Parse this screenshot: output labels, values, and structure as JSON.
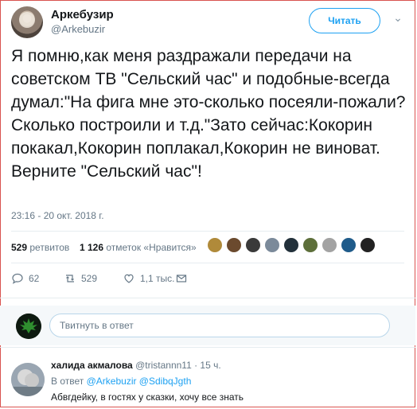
{
  "author": {
    "name": "Аркебузир",
    "handle": "@Arkebuzir",
    "follow_label": "Читать"
  },
  "tweet": {
    "text": "Я помню,как меня раздражали передачи на советском ТВ \"Сельский час\" и подобные-всегда думал:\"На фига мне это-сколько посеяли-пожали?Сколько построили и т.д.\"Зато сейчас:Кокорин покакал,Кокорин поплакал,Кокорин не виноват.\nВерните \"Сельский час\"!",
    "timestamp": "23:16 - 20 окт. 2018 г."
  },
  "stats": {
    "retweets_count": "529",
    "retweets_label": "ретвитов",
    "likes_count": "1 126",
    "likes_label": "отметок «Нравится»"
  },
  "actions": {
    "replies": "62",
    "retweets": "529",
    "likes": "1,1 тыс."
  },
  "reply_box": {
    "placeholder": "Твитнуть в ответ"
  },
  "reply": {
    "name": "халида акмалова",
    "handle": "@tristannn11",
    "time": "· 15 ч.",
    "to_prefix": "В ответ",
    "to_handles": "@Arkebuzir @SdibqJgth",
    "text": "Абвгдейку, в гостях у сказки, хочу все знать"
  },
  "colors": {
    "accent": "#1da1f2",
    "muted": "#657786",
    "text": "#14171a"
  }
}
